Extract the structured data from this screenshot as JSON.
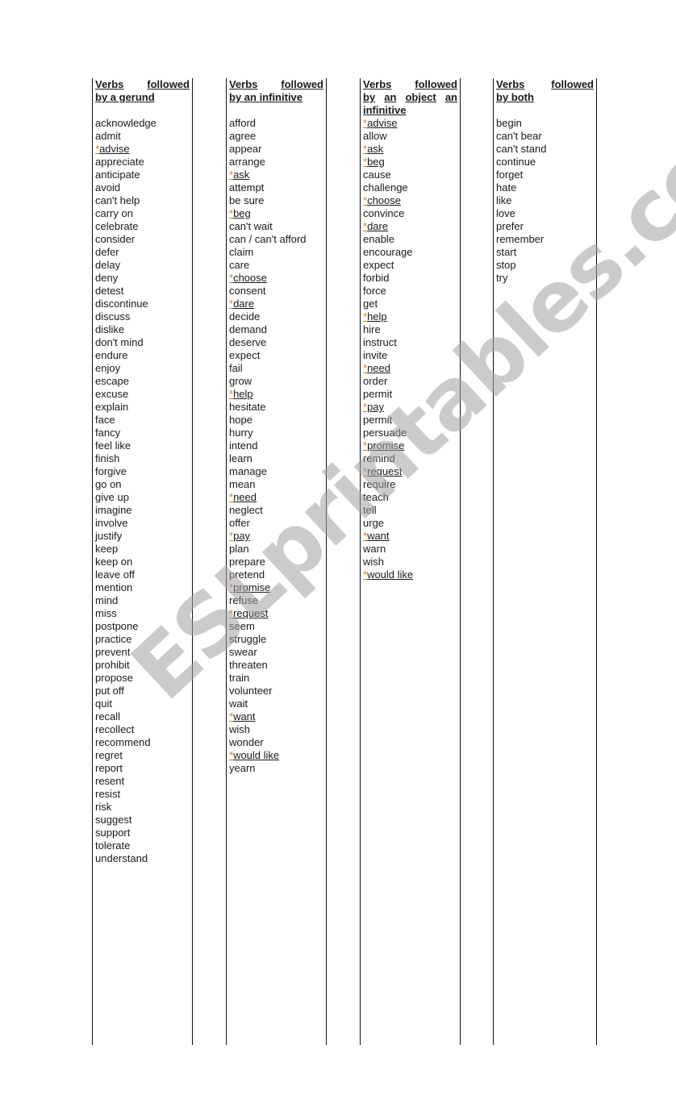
{
  "document": {
    "columns": [
      {
        "header_line1": [
          "Verbs",
          "followed"
        ],
        "header_rest": "by a gerund",
        "items": [
          {
            "text": "acknowledge"
          },
          {
            "text": "admit"
          },
          {
            "text": "advise",
            "marked": true
          },
          {
            "text": "appreciate"
          },
          {
            "text": "anticipate"
          },
          {
            "text": "avoid"
          },
          {
            "text": "can't help"
          },
          {
            "text": "carry on"
          },
          {
            "text": "celebrate"
          },
          {
            "text": "consider"
          },
          {
            "text": "defer"
          },
          {
            "text": "delay"
          },
          {
            "text": "deny"
          },
          {
            "text": "detest"
          },
          {
            "text": "discontinue"
          },
          {
            "text": "discuss"
          },
          {
            "text": "dislike"
          },
          {
            "text": "don't mind"
          },
          {
            "text": "endure"
          },
          {
            "text": "enjoy"
          },
          {
            "text": "escape"
          },
          {
            "text": "excuse"
          },
          {
            "text": "explain"
          },
          {
            "text": "face"
          },
          {
            "text": "fancy"
          },
          {
            "text": "feel like"
          },
          {
            "text": "finish"
          },
          {
            "text": "forgive"
          },
          {
            "text": "go on"
          },
          {
            "text": "give up"
          },
          {
            "text": "imagine"
          },
          {
            "text": "involve"
          },
          {
            "text": "justify"
          },
          {
            "text": "keep"
          },
          {
            "text": "keep on"
          },
          {
            "text": "leave off"
          },
          {
            "text": "mention"
          },
          {
            "text": "mind"
          },
          {
            "text": "miss"
          },
          {
            "text": "postpone"
          },
          {
            "text": "practice"
          },
          {
            "text": "prevent"
          },
          {
            "text": "prohibit"
          },
          {
            "text": "propose"
          },
          {
            "text": "put off"
          },
          {
            "text": "quit"
          },
          {
            "text": "recall"
          },
          {
            "text": "recollect"
          },
          {
            "text": "recommend"
          },
          {
            "text": "regret"
          },
          {
            "text": "report"
          },
          {
            "text": "resent"
          },
          {
            "text": "resist"
          },
          {
            "text": "risk"
          },
          {
            "text": "suggest"
          },
          {
            "text": "support"
          },
          {
            "text": "tolerate"
          },
          {
            "text": "understand"
          }
        ]
      },
      {
        "header_line1": [
          "Verbs",
          "followed"
        ],
        "header_rest": "by an infinitive",
        "items": [
          {
            "text": "afford"
          },
          {
            "text": "agree"
          },
          {
            "text": "appear"
          },
          {
            "text": "arrange"
          },
          {
            "text": "ask",
            "marked": true
          },
          {
            "text": "attempt"
          },
          {
            "text": "be sure"
          },
          {
            "text": "beg",
            "marked": true
          },
          {
            "text": "can't wait"
          },
          {
            "text": "can / can't afford"
          },
          {
            "text": "claim"
          },
          {
            "text": "care"
          },
          {
            "text": "choose",
            "marked": true
          },
          {
            "text": "consent"
          },
          {
            "text": "dare",
            "marked": true
          },
          {
            "text": "decide"
          },
          {
            "text": "demand"
          },
          {
            "text": "deserve"
          },
          {
            "text": "expect"
          },
          {
            "text": "fail"
          },
          {
            "text": "grow"
          },
          {
            "text": "help",
            "marked": true
          },
          {
            "text": "hesitate"
          },
          {
            "text": "hope"
          },
          {
            "text": "hurry"
          },
          {
            "text": "intend"
          },
          {
            "text": "learn"
          },
          {
            "text": "manage"
          },
          {
            "text": "mean"
          },
          {
            "text": "need",
            "marked": true
          },
          {
            "text": "neglect"
          },
          {
            "text": "offer"
          },
          {
            "text": "pay",
            "marked": true
          },
          {
            "text": "plan"
          },
          {
            "text": "prepare"
          },
          {
            "text": "pretend"
          },
          {
            "text": "promise",
            "marked": true
          },
          {
            "text": "refuse"
          },
          {
            "text": "request",
            "marked": true
          },
          {
            "text": "seem"
          },
          {
            "text": "struggle"
          },
          {
            "text": "swear"
          },
          {
            "text": "threaten"
          },
          {
            "text": "train"
          },
          {
            "text": "volunteer"
          },
          {
            "text": "wait"
          },
          {
            "text": "want",
            "marked": true
          },
          {
            "text": "wish"
          },
          {
            "text": "wonder"
          },
          {
            "text": "would like",
            "marked": true
          },
          {
            "text": "yearn"
          }
        ]
      },
      {
        "header_line1": [
          "Verbs",
          "followed"
        ],
        "header_line2": [
          "by",
          "an",
          "object",
          "an"
        ],
        "header_rest": "infinitive",
        "items": [
          {
            "text": "advise",
            "marked": true
          },
          {
            "text": "allow"
          },
          {
            "text": "ask",
            "marked": true
          },
          {
            "text": "beg",
            "marked": true
          },
          {
            "text": "cause"
          },
          {
            "text": "challenge"
          },
          {
            "text": "choose",
            "marked": true
          },
          {
            "text": "convince"
          },
          {
            "text": "dare",
            "marked": true
          },
          {
            "text": "enable"
          },
          {
            "text": "encourage"
          },
          {
            "text": "expect"
          },
          {
            "text": "forbid"
          },
          {
            "text": "force"
          },
          {
            "text": "get"
          },
          {
            "text": "help",
            "marked": true
          },
          {
            "text": "hire"
          },
          {
            "text": "instruct"
          },
          {
            "text": "invite"
          },
          {
            "text": "need",
            "marked": true
          },
          {
            "text": "order"
          },
          {
            "text": "permit"
          },
          {
            "text": "pay",
            "marked": true
          },
          {
            "text": "permit"
          },
          {
            "text": "persuade"
          },
          {
            "text": "promise",
            "marked": true
          },
          {
            "text": "remind"
          },
          {
            "text": "request",
            "marked": true
          },
          {
            "text": "require"
          },
          {
            "text": "teach"
          },
          {
            "text": "tell"
          },
          {
            "text": "urge"
          },
          {
            "text": "want",
            "marked": true
          },
          {
            "text": "warn"
          },
          {
            "text": "wish"
          },
          {
            "text": "would like",
            "marked": true
          }
        ]
      },
      {
        "header_line1": [
          "Verbs",
          "followed"
        ],
        "header_rest": "by both",
        "items": [
          {
            "text": "begin"
          },
          {
            "text": "can't bear"
          },
          {
            "text": "can't stand"
          },
          {
            "text": "continue"
          },
          {
            "text": "forget"
          },
          {
            "text": "hate"
          },
          {
            "text": "like"
          },
          {
            "text": "love"
          },
          {
            "text": "prefer"
          },
          {
            "text": "remember"
          },
          {
            "text": "start"
          },
          {
            "text": "stop"
          },
          {
            "text": "try"
          }
        ]
      }
    ],
    "marker": "*",
    "watermark": "ESLprintables.com",
    "colors": {
      "marker": "#e07a20",
      "text": "#1a1a1a",
      "rule": "#111111",
      "watermark": "#bfbfbf"
    }
  }
}
